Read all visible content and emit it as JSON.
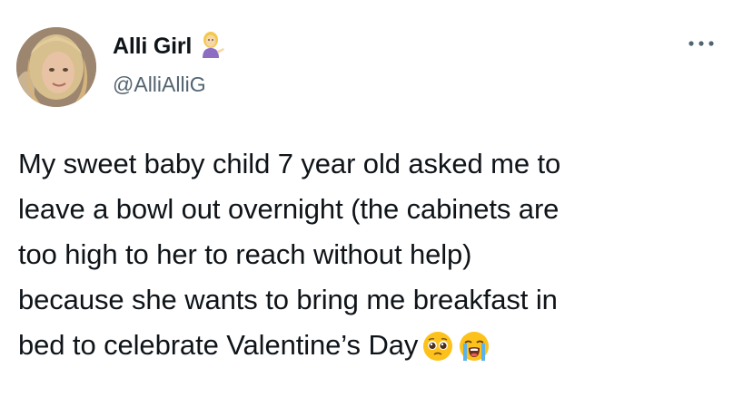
{
  "author": {
    "display_name": "Alli Girl",
    "name_emoji": "woman-tipping-hand-icon",
    "handle": "@AlliAlliG"
  },
  "tweet": {
    "lines": [
      "My sweet baby child 7 year old asked me to",
      "leave a bowl out overnight (the cabinets are",
      "too high to her to reach without help)",
      "because she wants to bring me breakfast in",
      "bed to celebrate Valentine’s Day"
    ],
    "trailing_emojis": [
      "pleading-face-icon",
      "loudly-crying-face-icon"
    ]
  },
  "colors": {
    "text": "#0f1419",
    "secondary": "#536471",
    "background": "#ffffff"
  }
}
